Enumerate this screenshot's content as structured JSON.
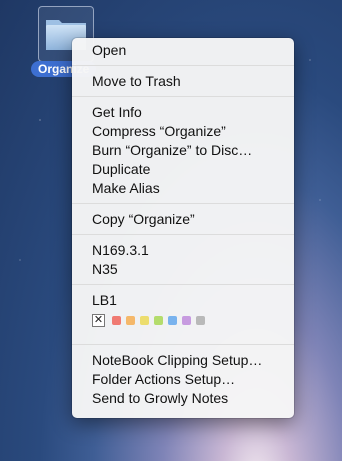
{
  "desktop": {
    "icon_label": "Organize"
  },
  "menu": {
    "group1": [
      "Open"
    ],
    "group2": [
      "Move to Trash"
    ],
    "group3": [
      "Get Info",
      "Compress “Organize”",
      "Burn “Organize” to Disc…",
      "Duplicate",
      "Make Alias"
    ],
    "group4": [
      "Copy “Organize”"
    ],
    "group5": [
      "N169.3.1",
      "N35"
    ],
    "labels_title": "LB1",
    "label_none": "✕",
    "label_colors": [
      "#f07a72",
      "#f5b86a",
      "#ecdd6e",
      "#b4dc6c",
      "#79b3ee",
      "#c79be0",
      "#b9b9b9"
    ],
    "group6": [
      "NoteBook Clipping Setup…",
      "Folder Actions Setup…",
      "Send to Growly Notes"
    ]
  }
}
